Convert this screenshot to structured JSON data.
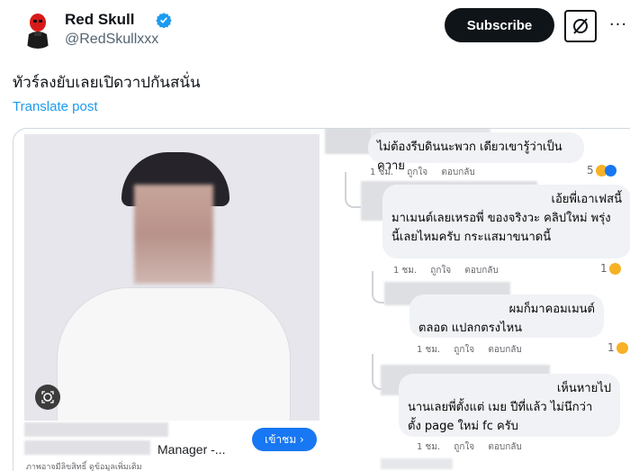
{
  "author": {
    "name": "Red Skull",
    "handle": "@RedSkullxxx",
    "verified": true
  },
  "header": {
    "subscribe_label": "Subscribe",
    "grok_icon": "slashed-square-icon",
    "more_icon": "more-icon",
    "more_label": "···"
  },
  "post": {
    "text": "ทัวร์ลงยับเลยเปิดวาปกันสนั่น",
    "translate_label": "Translate post"
  },
  "ad": {
    "title": "Manager -...",
    "visit_label": "เข้าชม ›",
    "footnote": "ภาพอาจมีลิขสิทธิ์ ดูข้อมูลเพิ่มเติม"
  },
  "comments": [
    {
      "text": "ไม่ต้องรีบดินนะพวก เดียวเขารู้ว่าเป็นควาย",
      "time": "1 ชม.",
      "like": "ถูกใจ",
      "reply": "ตอบกลับ",
      "reactions": "5"
    },
    {
      "line1": "เอ้ยพี่เอาเฟสนี้",
      "line2": "มาเมนต์เลยเหรอพี่ ของจริงวะ คลิปใหม่ พรุ่ง",
      "line3": "นี้เลยไหมครับ กระแสมาขนาดนี้",
      "time": "1 ชม.",
      "like": "ถูกใจ",
      "reply": "ตอบกลับ",
      "reactions": "1"
    },
    {
      "line1": "ผมก็มาคอมเมนต์",
      "line2": "ตลอด แปลกตรงไหน",
      "time": "1 ชม.",
      "like": "ถูกใจ",
      "reply": "ตอบกลับ",
      "reactions": "1"
    },
    {
      "line1": "เห็นหายไป",
      "line2": "นานเลยพี่ตั้งแต่ เมย ปีที่แล้ว ไม่นึกว่า",
      "line3": "ตั้ง page ใหม่ fc ครับ",
      "time": "1 ชม.",
      "like": "ถูกใจ",
      "reply": "ตอบกลับ"
    }
  ],
  "colors": {
    "accent": "#1d9bf0",
    "fb_blue": "#1877f2",
    "bubble": "#f0f2f5",
    "verified": "#1d9bf0"
  }
}
